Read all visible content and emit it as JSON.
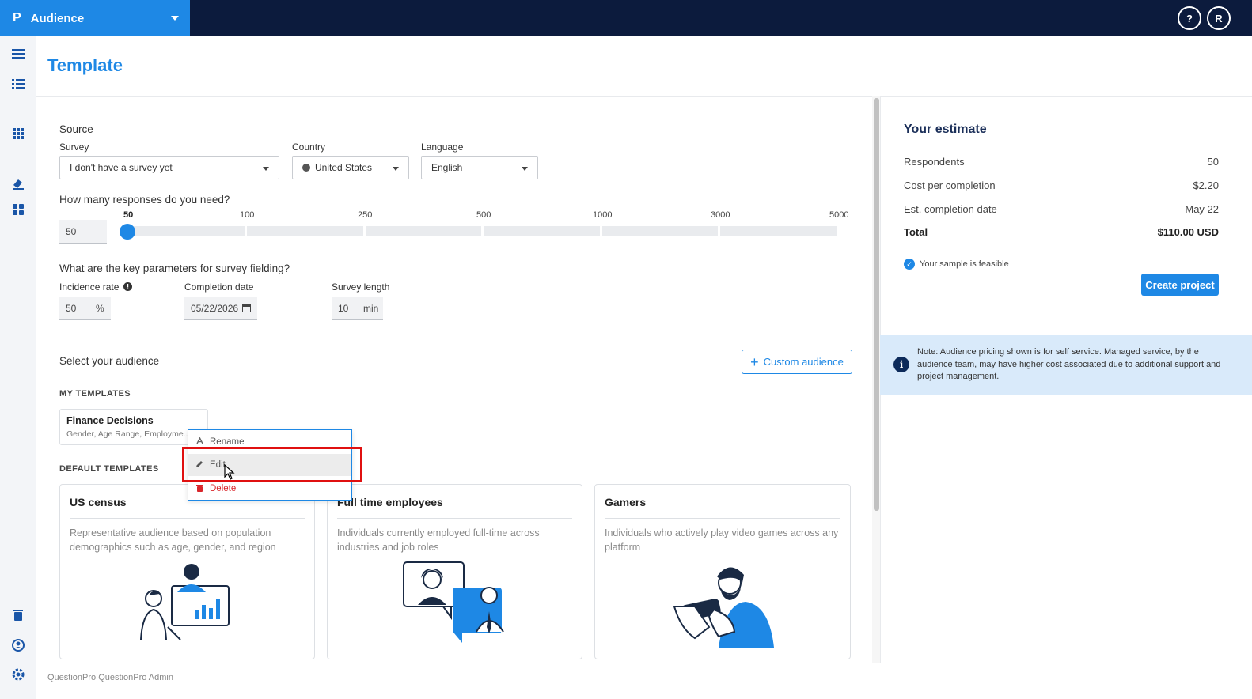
{
  "topbar": {
    "logo": "P",
    "app_name": "Audience",
    "help_label": "?",
    "user_initial": "R"
  },
  "page": {
    "title": "Template"
  },
  "source": {
    "heading": "Source",
    "survey_label": "Survey",
    "survey_value": "I don't have a survey yet",
    "country_label": "Country",
    "country_value": "United States",
    "language_label": "Language",
    "language_value": "English"
  },
  "responses": {
    "question": "How many responses do you need?",
    "value": "50",
    "ticks": [
      "50",
      "100",
      "250",
      "500",
      "1000",
      "3000",
      "5000"
    ],
    "selected_tick": "50"
  },
  "parameters": {
    "question": "What are the key parameters for survey fielding?",
    "incidence_label": "Incidence rate",
    "incidence_value": "50",
    "incidence_unit": "%",
    "completion_label": "Completion date",
    "completion_value": "05/22/2026",
    "length_label": "Survey length",
    "length_value": "10",
    "length_unit": "min"
  },
  "audience": {
    "heading": "Select your audience",
    "custom_button": "Custom audience",
    "my_templates_heading": "MY TEMPLATES",
    "my_template": {
      "title": "Finance Decisions",
      "subtitle": "Gender, Age Range, Employme..."
    },
    "default_templates_heading": "DEFAULT TEMPLATES",
    "cards": [
      {
        "title": "US census",
        "description": "Representative audience based on population demographics such as age, gender, and region"
      },
      {
        "title": "Full time employees",
        "description": "Individuals currently employed full-time across industries and job roles"
      },
      {
        "title": "Gamers",
        "description": "Individuals who actively play video games across any platform"
      }
    ]
  },
  "context_menu": {
    "items": [
      {
        "label": "Rename",
        "icon": "rename-icon"
      },
      {
        "label": "Edit",
        "icon": "pencil-icon"
      },
      {
        "label": "Delete",
        "icon": "trash-icon"
      }
    ]
  },
  "estimate": {
    "title": "Your estimate",
    "rows": [
      {
        "label": "Respondents",
        "value": "50"
      },
      {
        "label": "Cost per completion",
        "value": "$2.20"
      },
      {
        "label": "Est. completion date",
        "value": "May 22"
      }
    ],
    "total_label": "Total",
    "total_value": "$110.00 USD",
    "feasible_text": "Your sample is feasible",
    "create_button": "Create project",
    "note": "Note: Audience pricing shown is for self service. Managed service, by the audience team, may have higher cost associated due to additional support and project management."
  },
  "footer": {
    "text": "QuestionPro QuestionPro Admin"
  },
  "colors": {
    "brand_blue": "#1e88e5",
    "topbar_navy": "#0c1b3d",
    "danger_red": "#d9262b",
    "highlight_red": "#e01010"
  }
}
